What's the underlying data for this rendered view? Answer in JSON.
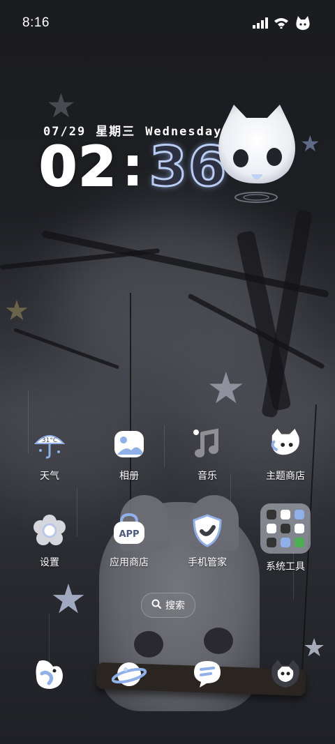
{
  "status_bar": {
    "time": "8:16",
    "icons": [
      "signal-icon",
      "wifi-icon",
      "cat-ghost-icon"
    ]
  },
  "clock_widget": {
    "date": "07/29",
    "weekday_cn": "星期三",
    "weekday_en": "Wednesday",
    "hours": "02",
    "separator": ":",
    "minutes": "36"
  },
  "apps_row1": [
    {
      "label": "天气",
      "icon": "weather-umbrella-icon",
      "badge": "31°C"
    },
    {
      "label": "相册",
      "icon": "gallery-icon"
    },
    {
      "label": "音乐",
      "icon": "music-note-icon"
    },
    {
      "label": "主题商店",
      "icon": "theme-store-icon"
    }
  ],
  "apps_row2": [
    {
      "label": "设置",
      "icon": "settings-flower-icon"
    },
    {
      "label": "应用商店",
      "icon": "app-store-icon",
      "badge": "APP"
    },
    {
      "label": "手机管家",
      "icon": "shield-icon"
    },
    {
      "label": "系统工具",
      "icon": "system-tools-folder-icon"
    }
  ],
  "search": {
    "label": "搜索"
  },
  "dock": [
    {
      "icon": "phone-icon"
    },
    {
      "icon": "planet-browser-icon"
    },
    {
      "icon": "message-bubble-icon"
    },
    {
      "icon": "camera-ghost-icon"
    }
  ],
  "colors": {
    "accent": "#b9cdf2",
    "icon_blue": "#8fb0e8"
  }
}
